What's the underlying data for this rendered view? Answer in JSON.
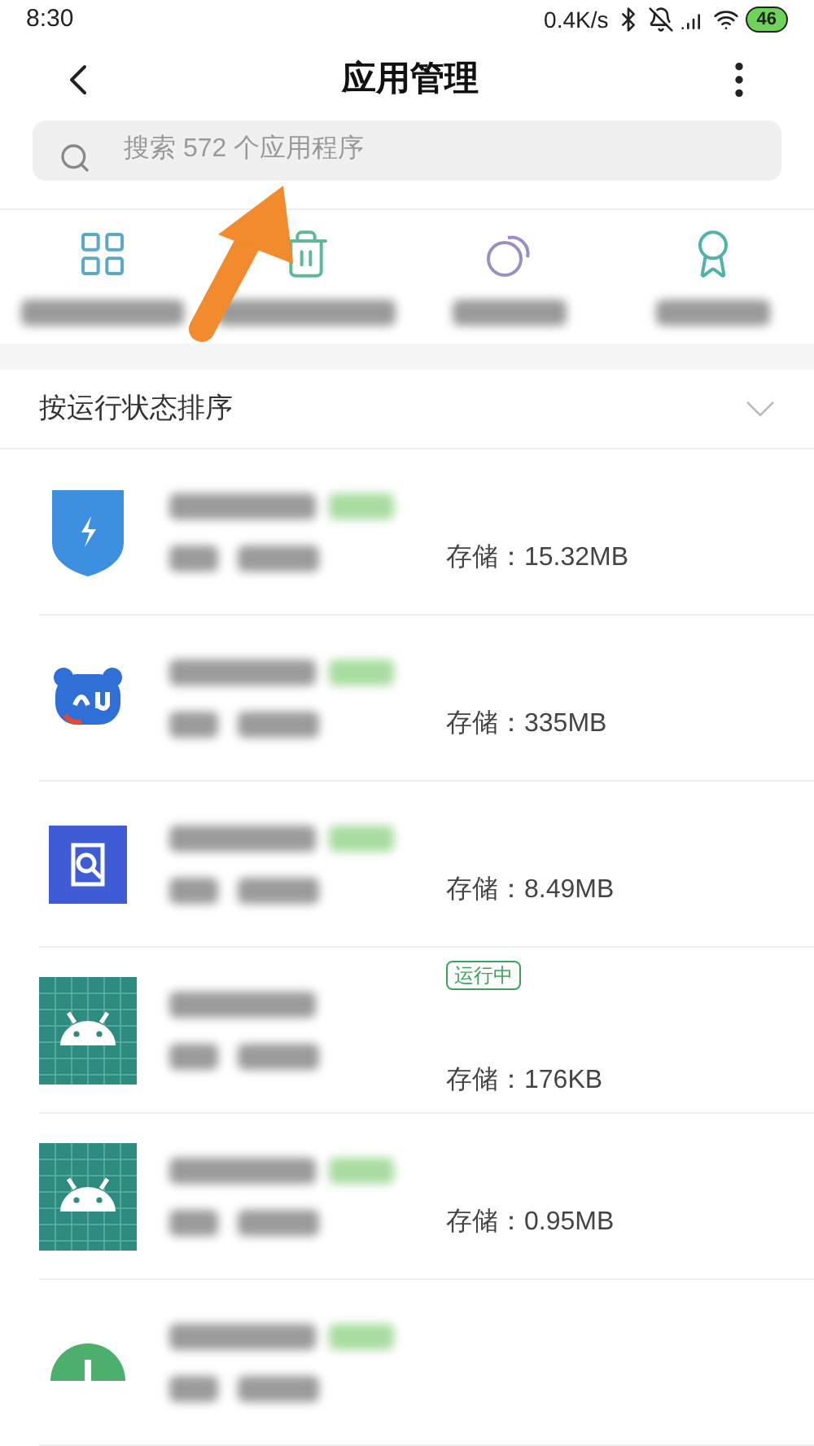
{
  "status_bar": {
    "time": "8:30",
    "speed": "0.4K/s",
    "battery": "46"
  },
  "header": {
    "title": "应用管理"
  },
  "search": {
    "placeholder": "搜索 572 个应用程序"
  },
  "quick_actions": [
    {
      "kind": "grid"
    },
    {
      "kind": "trash"
    },
    {
      "kind": "circles"
    },
    {
      "kind": "award"
    }
  ],
  "sort": {
    "label": "按运行状态排序"
  },
  "apps": [
    {
      "kind": "shield",
      "storage": "存储：15.32MB"
    },
    {
      "kind": "du",
      "storage": "存储：335MB"
    },
    {
      "kind": "docsearch",
      "storage": "存储：8.49MB"
    },
    {
      "kind": "android",
      "status_label": "运行中",
      "storage": "存储：176KB"
    },
    {
      "kind": "android",
      "storage": "存储：0.95MB"
    },
    {
      "kind": "greencircle"
    }
  ]
}
